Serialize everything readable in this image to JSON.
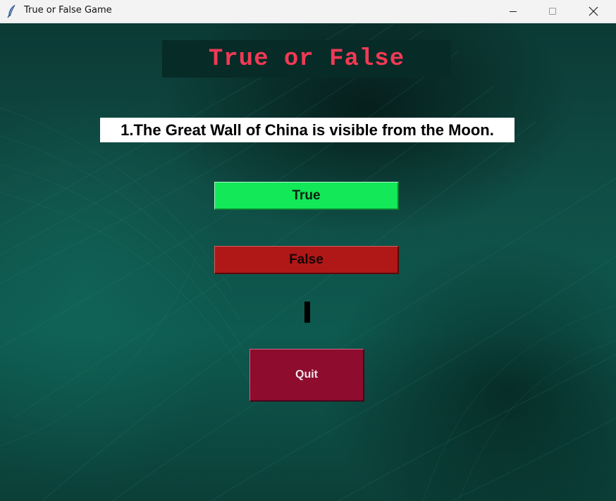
{
  "window": {
    "title": "True or False Game",
    "icon": "feather-icon",
    "controls": [
      "minimize-icon",
      "maximize-icon",
      "close-icon"
    ]
  },
  "game": {
    "heading": "True or False",
    "question": "1.The Great Wall of China is visible from the Moon.",
    "buttons": {
      "true_label": "True",
      "false_label": "False",
      "quit_label": "Quit"
    },
    "feedback": ""
  },
  "colors": {
    "heading_text": "#f03a55",
    "heading_bg": "#072b27",
    "true_button": "#12e858",
    "false_button": "#b01818",
    "quit_button": "#8e0c2e",
    "background": "#0e5a50"
  }
}
